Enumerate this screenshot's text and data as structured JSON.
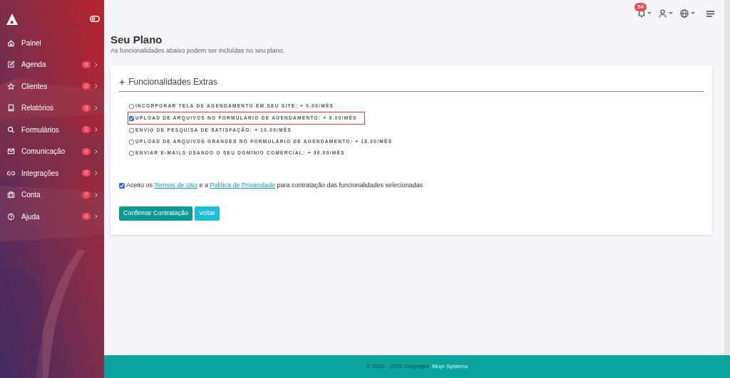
{
  "sidebar": {
    "items": [
      {
        "label": "Painel",
        "selected": false
      },
      {
        "label": "Agenda",
        "badge": "9",
        "selected": false
      },
      {
        "label": "Clientes",
        "badge": "2",
        "selected": false
      },
      {
        "label": "Relatórios",
        "badge": "3",
        "selected": false
      },
      {
        "label": "Formulários",
        "badge": "1",
        "selected": false
      },
      {
        "label": "Comunicação",
        "badge": "4",
        "selected": false
      },
      {
        "label": "Integrações",
        "badge": "6",
        "selected": false
      },
      {
        "label": "Conta",
        "badge": "7",
        "selected": false
      },
      {
        "label": "Ajuda",
        "badge": "4",
        "selected": false
      }
    ]
  },
  "topbar": {
    "notifications": "54"
  },
  "page": {
    "title": "Seu Plano",
    "subtitle": "As funcionalidades abaixo podem ser incluídas no seu plano."
  },
  "card": {
    "toggle": "+",
    "title": "Funcionalidades Extras",
    "features": [
      {
        "label": "INCORPORAR TELA DE AGENDAMENTO EM SEU SITE: + 0.00/MÊS",
        "checked": false,
        "highlighted": false
      },
      {
        "label": "UPLOAD DE ARQUIVOS NO FORMULÁRIO DE AGENDAMENTO: + 9.00/MÊS",
        "checked": true,
        "highlighted": true
      },
      {
        "label": "ENVIO DE PESQUISA DE SATISFAÇÃO: + 10.00/MÊS",
        "checked": false,
        "highlighted": false
      },
      {
        "label": "UPLOAD DE ARQUIVOS GRANDES NO FORMULÁRIO DE AGENDAMENTO: + 18.00/MÊS",
        "checked": false,
        "highlighted": false
      },
      {
        "label": "ENVIAR E-MAILS USANDO O SEU DOMÍNIO COMERCIAL: + 30.00/MÊS",
        "checked": false,
        "highlighted": false
      }
    ],
    "terms": {
      "checked": true,
      "before": "Aceito os",
      "link1": "Termos de Uso",
      "middle": "e a",
      "link2": "Política de Privacidade",
      "after": "para contratação das funcionalidades selecionadas"
    },
    "buttons": [
      {
        "label": "Confirmar Contratação",
        "kind": "primary"
      },
      {
        "label": "Voltar",
        "kind": "secondary"
      }
    ]
  },
  "footer": {
    "text": "© 2020 - 2025 Copyright:",
    "brand": "Mupi Systems"
  }
}
